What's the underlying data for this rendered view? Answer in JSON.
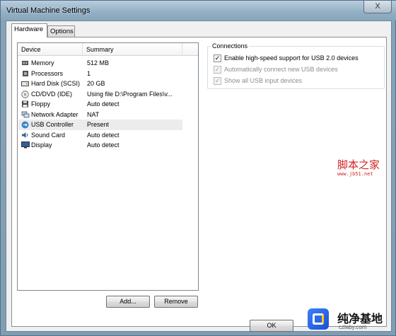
{
  "window": {
    "title": "Virtual Machine Settings",
    "close_glyph": "X"
  },
  "tabs": [
    {
      "label": "Hardware",
      "active": true
    },
    {
      "label": "Options",
      "active": false
    }
  ],
  "device_list": {
    "columns": [
      "Device",
      "Summary"
    ],
    "rows": [
      {
        "icon": "memory-icon",
        "device": "Memory",
        "summary": "512 MB",
        "selected": false
      },
      {
        "icon": "processor-icon",
        "device": "Processors",
        "summary": "1",
        "selected": false
      },
      {
        "icon": "hard-disk-icon",
        "device": "Hard Disk (SCSI)",
        "summary": "20 GB",
        "selected": false
      },
      {
        "icon": "cd-dvd-icon",
        "device": "CD/DVD (IDE)",
        "summary": "Using file D:\\Program Files\\v...",
        "selected": false
      },
      {
        "icon": "floppy-icon",
        "device": "Floppy",
        "summary": "Auto detect",
        "selected": false
      },
      {
        "icon": "network-adapter-icon",
        "device": "Network Adapter",
        "summary": "NAT",
        "selected": false
      },
      {
        "icon": "usb-icon",
        "device": "USB Controller",
        "summary": "Present",
        "selected": true
      },
      {
        "icon": "sound-card-icon",
        "device": "Sound Card",
        "summary": "Auto detect",
        "selected": false
      },
      {
        "icon": "display-icon",
        "device": "Display",
        "summary": "Auto detect",
        "selected": false
      }
    ]
  },
  "buttons": {
    "add": "Add...",
    "remove": "Remove",
    "ok": "OK"
  },
  "connections": {
    "title": "Connections",
    "options": [
      {
        "label": "Enable high-speed support for USB 2.0 devices",
        "checked": true,
        "enabled": true
      },
      {
        "label": "Automatically connect new USB devices",
        "checked": true,
        "enabled": false
      },
      {
        "label": "Show all USB input devices",
        "checked": true,
        "enabled": false
      }
    ]
  },
  "watermarks": {
    "site1": "脚本之家",
    "site1_url": "www.jb51.net",
    "site2": "纯净基地",
    "site2_url": "czlaby.com"
  },
  "colors": {
    "title_bar": "#94b0c5",
    "selected_row": "#ececec",
    "watermark_red": "#d21f1f"
  }
}
